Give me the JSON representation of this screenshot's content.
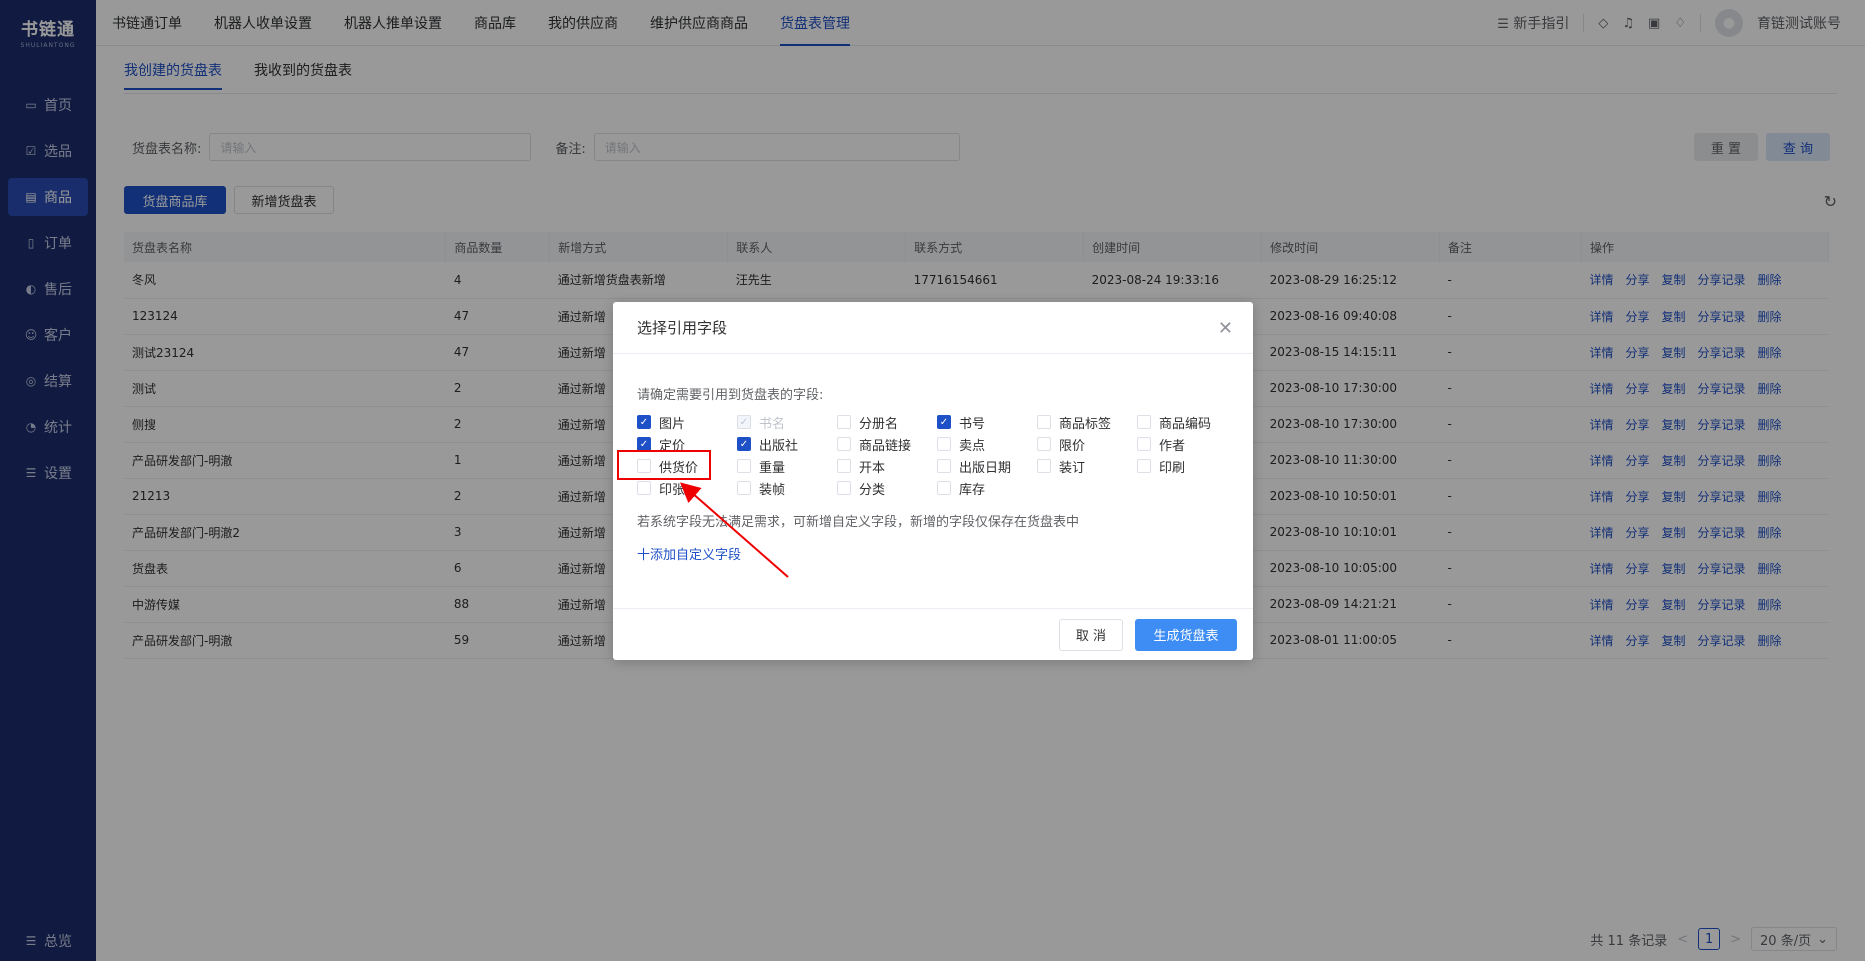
{
  "logo": {
    "main": "书链通",
    "sub": "SHULIANTONG"
  },
  "sidebar": {
    "items": [
      {
        "label": "首页",
        "icon": "monitor-icon",
        "glyph": "▭"
      },
      {
        "label": "选品",
        "icon": "checklist-icon",
        "glyph": "☑"
      },
      {
        "label": "商品",
        "icon": "box-icon",
        "glyph": "▤"
      },
      {
        "label": "订单",
        "icon": "document-icon",
        "glyph": "▯"
      },
      {
        "label": "售后",
        "icon": "headset-icon",
        "glyph": "◐"
      },
      {
        "label": "客户",
        "icon": "users-icon",
        "glyph": "☺"
      },
      {
        "label": "结算",
        "icon": "settle-icon",
        "glyph": "◎"
      },
      {
        "label": "统计",
        "icon": "pie-icon",
        "glyph": "◔"
      },
      {
        "label": "设置",
        "icon": "settings-icon",
        "glyph": "☰"
      }
    ],
    "active_index": 2,
    "bottom_label": "总览"
  },
  "topbar": {
    "tabs": [
      "书链通订单",
      "机器人收单设置",
      "机器人推单设置",
      "商品库",
      "我的供应商",
      "维护供应商商品",
      "货盘表管理"
    ],
    "active_index": 6,
    "guide_label": "新手指引",
    "account": "育链测试账号"
  },
  "subtabs": {
    "items": [
      "我创建的货盘表",
      "我收到的货盘表"
    ],
    "active_index": 0
  },
  "filters": {
    "name_label": "货盘表名称:",
    "name_placeholder": "请输入",
    "remark_label": "备注:",
    "remark_placeholder": "请输入",
    "reset": "重 置",
    "query": "查 询"
  },
  "actions": {
    "library": "货盘商品库",
    "add": "新增货盘表"
  },
  "table": {
    "columns": [
      "货盘表名称",
      "商品数量",
      "新增方式",
      "联系人",
      "联系方式",
      "创建时间",
      "修改时间",
      "备注",
      "操作"
    ],
    "ops": [
      "详情",
      "分享",
      "复制",
      "分享记录",
      "删除"
    ],
    "rows": [
      {
        "name": "冬风",
        "count": "4",
        "method": "通过新增货盘表新增",
        "contact": "汪先生",
        "phone": "17716154661",
        "created": "2023-08-24 19:33:16",
        "modified": "2023-08-29 16:25:12",
        "remark": "-"
      },
      {
        "name": "123124",
        "count": "47",
        "method": "通过新增",
        "contact": "",
        "phone": "",
        "created": "",
        "modified": "2023-08-16 09:40:08",
        "remark": "-"
      },
      {
        "name": "测试23124",
        "count": "47",
        "method": "通过新增",
        "contact": "",
        "phone": "",
        "created": "",
        "modified": "2023-08-15 14:15:11",
        "remark": "-"
      },
      {
        "name": "测试",
        "count": "2",
        "method": "通过新增",
        "contact": "",
        "phone": "",
        "created": "",
        "modified": "2023-08-10 17:30:00",
        "remark": "-"
      },
      {
        "name": "侧搜",
        "count": "2",
        "method": "通过新增",
        "contact": "",
        "phone": "",
        "created": "",
        "modified": "2023-08-10 17:30:00",
        "remark": "-"
      },
      {
        "name": "产品研发部门-明澈",
        "count": "1",
        "method": "通过新增",
        "contact": "",
        "phone": "",
        "created": "",
        "modified": "2023-08-10 11:30:00",
        "remark": "-"
      },
      {
        "name": "21213",
        "count": "2",
        "method": "通过新增",
        "contact": "",
        "phone": "",
        "created": "",
        "modified": "2023-08-10 10:50:01",
        "remark": "-"
      },
      {
        "name": "产品研发部门-明澈2",
        "count": "3",
        "method": "通过新增",
        "contact": "",
        "phone": "",
        "created": "",
        "modified": "2023-08-10 10:10:01",
        "remark": "-"
      },
      {
        "name": "货盘表",
        "count": "6",
        "method": "通过新增",
        "contact": "",
        "phone": "",
        "created": "",
        "modified": "2023-08-10 10:05:00",
        "remark": "-"
      },
      {
        "name": "中游传媒",
        "count": "88",
        "method": "通过新增",
        "contact": "",
        "phone": "",
        "created": "",
        "modified": "2023-08-09 14:21:21",
        "remark": "-"
      },
      {
        "name": "产品研发部门-明澈",
        "count": "59",
        "method": "通过新增",
        "contact": "",
        "phone": "",
        "created": "",
        "modified": "2023-08-01 11:00:05",
        "remark": "-"
      }
    ]
  },
  "pager": {
    "total": "共 11 条记录",
    "prev": "<",
    "current": "1",
    "next": ">",
    "size": "20 条/页"
  },
  "modal": {
    "title": "选择引用字段",
    "hint": "请确定需要引用到货盘表的字段:",
    "fields": [
      {
        "label": "图片",
        "checked": true,
        "disabled": false
      },
      {
        "label": "书名",
        "checked": true,
        "disabled": true
      },
      {
        "label": "分册名",
        "checked": false,
        "disabled": false
      },
      {
        "label": "书号",
        "checked": true,
        "disabled": false
      },
      {
        "label": "商品标签",
        "checked": false,
        "disabled": false
      },
      {
        "label": "商品编码",
        "checked": false,
        "disabled": false
      },
      {
        "label": "定价",
        "checked": true,
        "disabled": false
      },
      {
        "label": "出版社",
        "checked": true,
        "disabled": false
      },
      {
        "label": "商品链接",
        "checked": false,
        "disabled": false
      },
      {
        "label": "卖点",
        "checked": false,
        "disabled": false
      },
      {
        "label": "限价",
        "checked": false,
        "disabled": false
      },
      {
        "label": "作者",
        "checked": false,
        "disabled": false
      },
      {
        "label": "供货价",
        "checked": false,
        "disabled": false
      },
      {
        "label": "重量",
        "checked": false,
        "disabled": false
      },
      {
        "label": "开本",
        "checked": false,
        "disabled": false
      },
      {
        "label": "出版日期",
        "checked": false,
        "disabled": false
      },
      {
        "label": "装订",
        "checked": false,
        "disabled": false
      },
      {
        "label": "印刷",
        "checked": false,
        "disabled": false
      },
      {
        "label": "印张",
        "checked": false,
        "disabled": false
      },
      {
        "label": "装帧",
        "checked": false,
        "disabled": false
      },
      {
        "label": "分类",
        "checked": false,
        "disabled": false
      },
      {
        "label": "库存",
        "checked": false,
        "disabled": false
      }
    ],
    "note": "若系统字段无法满足需求，可新增自定义字段，新增的字段仅保存在货盘表中",
    "add_link": "十添加自定义字段",
    "cancel": "取 消",
    "generate": "生成货盘表"
  },
  "colors": {
    "sidebar": "#1d2e6e",
    "primary": "#1e50c8",
    "annotation": "#e00000"
  }
}
